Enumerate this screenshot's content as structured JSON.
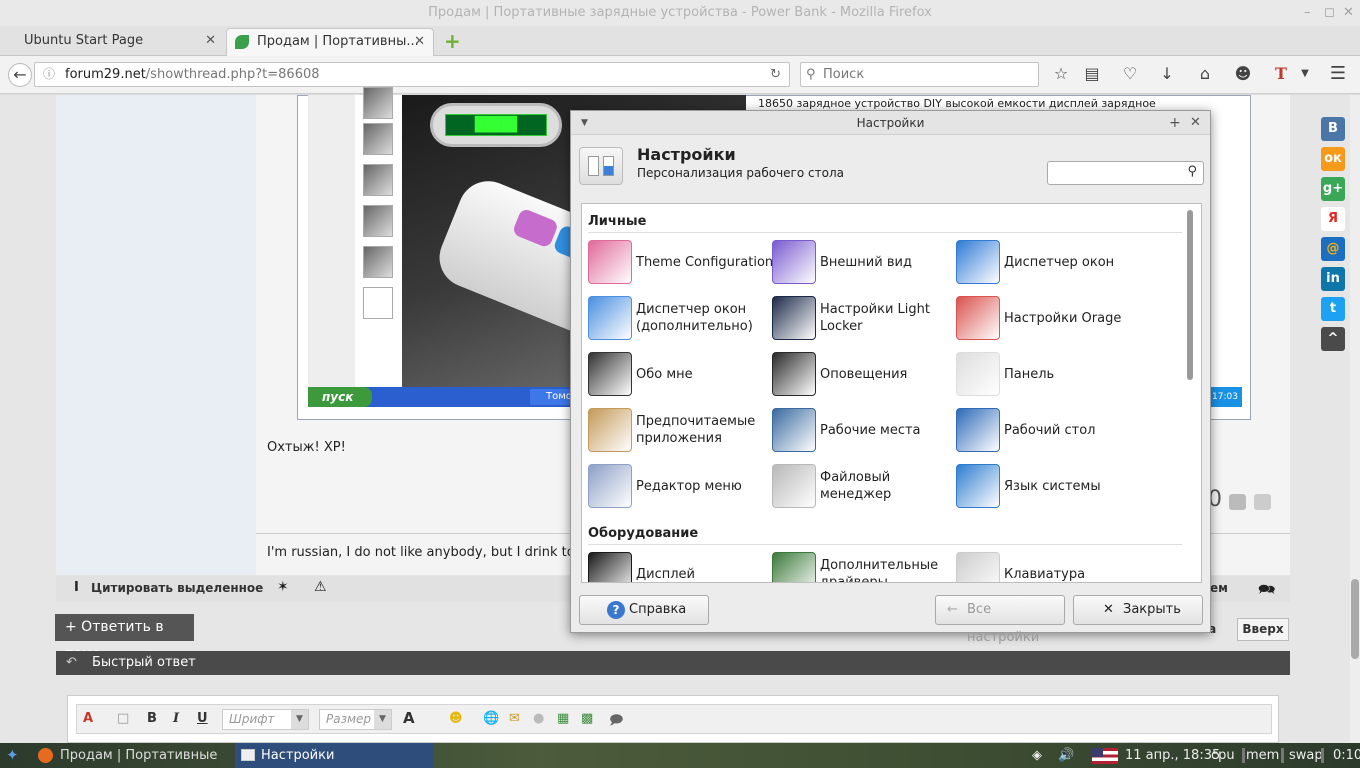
{
  "window": {
    "title": "Продам | Портативные зарядные устройства - Power Bank - Mozilla Firefox"
  },
  "tabs": [
    {
      "label": "Ubuntu Start Page"
    },
    {
      "label": "Продам | Портативны..."
    }
  ],
  "nav": {
    "url_host": "forum29.net",
    "url_path": "/showthread.php?t=86608",
    "search_placeholder": "Поиск"
  },
  "post": {
    "text_top": "18650 зарядное устройство DIY высокой емкости дисплей зарядное",
    "xp_start": "пуск",
    "xp_task": "Томо н",
    "xp_clock": "17:03",
    "comment": "Охтыж! XP!",
    "signature": "I'm russian, I do not like anybody, but I drink to",
    "rating": "0"
  },
  "post_footer": {
    "quote_label": "Цитировать выделенное",
    "right_label": "ем"
  },
  "reply_button": "+ Ответить в теме",
  "pager_right": "ка",
  "top_button": "Вверх",
  "quick_reply": "Быстрый ответ",
  "editor": {
    "font_placeholder": "Шрифт",
    "size_placeholder": "Размер",
    "bold": "B",
    "italic": "I",
    "underline": "U",
    "text_color": "A"
  },
  "social": [
    {
      "label": "В",
      "color": "#4a76a8"
    },
    {
      "label": "ок",
      "color": "#f59a1b"
    },
    {
      "label": "g+",
      "color": "#3aa757"
    },
    {
      "label": "Я",
      "color": "#ffffff",
      "fg": "#e52620"
    },
    {
      "label": "@",
      "color": "#1b6ec2",
      "fg": "#ffb000"
    },
    {
      "label": "in",
      "color": "#0e76a8"
    },
    {
      "label": "t",
      "color": "#1da1f2"
    },
    {
      "label": "^",
      "color": "#4a4a4a"
    }
  ],
  "dialog": {
    "title": "Настройки",
    "heading": "Настройки",
    "subheading": "Персонализация рабочего стола",
    "categories": [
      {
        "name": "Личные",
        "items": [
          {
            "label": "Theme Configuration",
            "icon": "theme-config-icon",
            "color": "#e06a9a"
          },
          {
            "label": "Внешний вид",
            "icon": "appearance-icon",
            "color": "#7a5ad0"
          },
          {
            "label": "Диспетчер окон",
            "icon": "window-manager-icon",
            "color": "#2f7bd6"
          },
          {
            "label": "Диспетчер окон (дополнительно)",
            "icon": "window-manager-tweaks-icon",
            "color": "#4a8fe0"
          },
          {
            "label": "Настройки Light Locker",
            "icon": "light-locker-icon",
            "color": "#1c2a4a"
          },
          {
            "label": "Настройки Orage",
            "icon": "calendar-icon",
            "color": "#d9534f"
          },
          {
            "label": "Обо мне",
            "icon": "about-me-icon",
            "color": "#333333"
          },
          {
            "label": "Оповещения",
            "icon": "notifications-icon",
            "color": "#2a2a2a"
          },
          {
            "label": "Панель",
            "icon": "panel-icon",
            "color": "#dddddd"
          },
          {
            "label": "Предпочитаемые приложения",
            "icon": "preferred-apps-icon",
            "color": "#c49a5a"
          },
          {
            "label": "Рабочие места",
            "icon": "workspaces-icon",
            "color": "#3a6aa0"
          },
          {
            "label": "Рабочий стол",
            "icon": "desktop-icon",
            "color": "#2e6bb8"
          },
          {
            "label": "Редактор меню",
            "icon": "menu-editor-icon",
            "color": "#8ea0c8"
          },
          {
            "label": "Файловый менеджер",
            "icon": "file-manager-icon",
            "color": "#b8b8b8"
          },
          {
            "label": "Язык системы",
            "icon": "language-icon",
            "color": "#2d7dcf"
          }
        ]
      },
      {
        "name": "Оборудование",
        "items": [
          {
            "label": "Дисплей",
            "icon": "display-icon",
            "color": "#1a1a1a"
          },
          {
            "label": "Дополнительные драйверы",
            "icon": "drivers-icon",
            "color": "#3c7a3c"
          },
          {
            "label": "Клавиатура",
            "icon": "keyboard-icon",
            "color": "#cccccc"
          }
        ]
      }
    ],
    "help_button": "Справка",
    "all_settings_button": "Все настройки",
    "close_button": "Закрыть"
  },
  "taskbar": {
    "tasks": [
      {
        "label": "Продам | Портативные з..."
      },
      {
        "label": "Настройки"
      }
    ],
    "datetime": "11 апр., 18:35",
    "cpu": "cpu",
    "mem": "mem",
    "swap": "swap",
    "uptime": "0:10"
  }
}
